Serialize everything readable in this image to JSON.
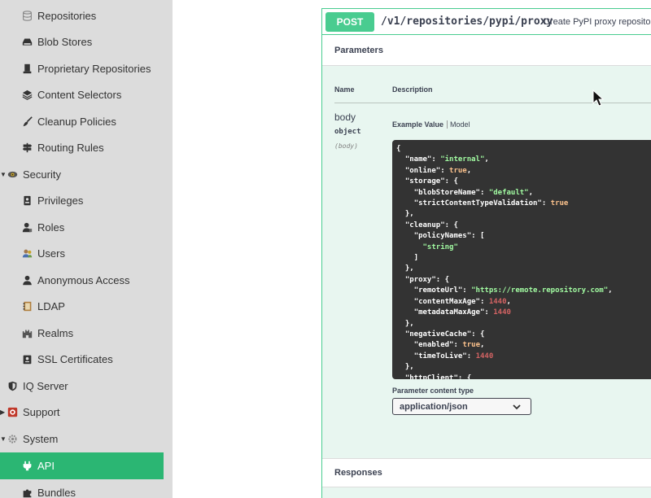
{
  "sidebar": {
    "items": [
      {
        "label": "Repositories",
        "icon": "database-icon"
      },
      {
        "label": "Blob Stores",
        "icon": "hard-drive-icon"
      },
      {
        "label": "Proprietary Repositories",
        "icon": "proprietary-icon"
      },
      {
        "label": "Content Selectors",
        "icon": "layers-icon"
      },
      {
        "label": "Cleanup Policies",
        "icon": "broom-icon"
      },
      {
        "label": "Routing Rules",
        "icon": "signpost-icon"
      },
      {
        "label": "Security",
        "icon": "eye-icon",
        "expanded": true
      },
      {
        "label": "Privileges",
        "icon": "id-badge-icon"
      },
      {
        "label": "Roles",
        "icon": "user-tie-icon"
      },
      {
        "label": "Users",
        "icon": "users-icon"
      },
      {
        "label": "Anonymous Access",
        "icon": "user-icon"
      },
      {
        "label": "LDAP",
        "icon": "address-book-icon"
      },
      {
        "label": "Realms",
        "icon": "castle-icon"
      },
      {
        "label": "SSL Certificates",
        "icon": "certificate-icon"
      },
      {
        "label": "IQ Server",
        "icon": "shield-icon"
      },
      {
        "label": "Support",
        "icon": "lifebuoy-icon",
        "expanded": false
      },
      {
        "label": "System",
        "icon": "gear-icon",
        "expanded": true
      },
      {
        "label": "API",
        "icon": "plug-icon",
        "active": true
      },
      {
        "label": "Bundles",
        "icon": "puzzle-icon"
      }
    ]
  },
  "operation": {
    "method": "POST",
    "path": "/v1/repositories/pypi/proxy",
    "summary": "Create PyPI proxy repository",
    "parameters_title": "Parameters",
    "col_name": "Name",
    "col_description": "Description",
    "param_name": "body",
    "param_type": "object",
    "param_in": "(body)",
    "tab_example": "Example Value",
    "tab_model": "Model",
    "content_type_label": "Parameter content type",
    "content_type_value": "application/json",
    "responses_title": "Responses"
  },
  "colors": {
    "post_green": "#49cc90",
    "active_nav": "#2bb673",
    "code_bg": "#333333"
  }
}
